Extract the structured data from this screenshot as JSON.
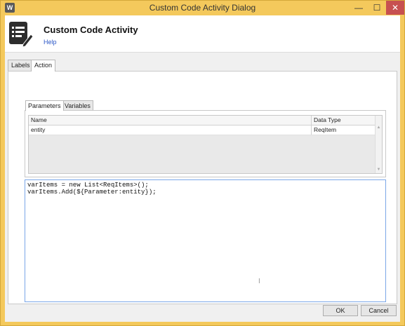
{
  "window": {
    "app_icon": "W",
    "title": "Custom Code Activity Dialog",
    "minimize": "—",
    "maximize": "☐",
    "close": "✕"
  },
  "header": {
    "icon": "document-edit-icon",
    "title": "Custom Code Activity",
    "help_link": "Help"
  },
  "tabs": [
    {
      "label": "Labels",
      "active": false
    },
    {
      "label": "Action",
      "active": true
    }
  ],
  "subtabs": [
    {
      "label": "Parameters",
      "active": true
    },
    {
      "label": "Variables",
      "active": false
    }
  ],
  "parameters_grid": {
    "columns": [
      "Name",
      "Data Type"
    ],
    "rows": [
      {
        "name": "entity",
        "data_type": "ReqItem"
      }
    ]
  },
  "code": "varItems = new List<ReqItems>();\nvarItems.Add(${Parameter:entity});",
  "buttons": {
    "ok": "OK",
    "cancel": "Cancel"
  },
  "colors": {
    "titlebar": "#f4c95c",
    "close_button": "#c75050",
    "link": "#2a56c6",
    "editor_border": "#7aa6e8"
  }
}
